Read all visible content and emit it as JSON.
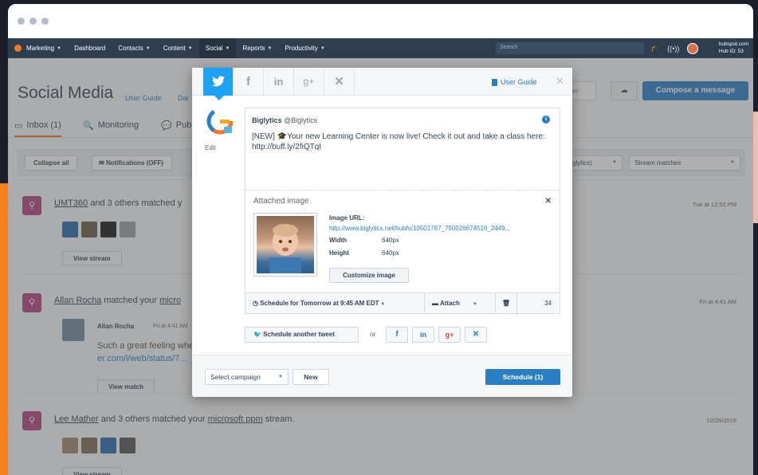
{
  "nav": {
    "brand": "Marketing",
    "items": [
      "Dashboard",
      "Contacts",
      "Content",
      "Social",
      "Reports",
      "Productivity"
    ],
    "search_placeholder": "Search",
    "hub_line1": "hubspot.com",
    "hub_line2": "Hub ID: 53"
  },
  "page": {
    "title": "Social Media",
    "user_guide": "User Guide",
    "title_link2": "Dai",
    "filter_btn": "fter",
    "compose": "Compose a message",
    "tabs": [
      "Inbox (1)",
      "Monitoring",
      "Pub"
    ]
  },
  "filterbar": {
    "collapse": "Collapse all",
    "notifications": "Notifications (OFF)",
    "account_select": "glytics)",
    "stream_select": "Stream matches"
  },
  "stream": [
    {
      "user": "UMT360",
      "text": " and 3 others matched y",
      "date": "Tue at 12:52 PM",
      "button": "View stream"
    },
    {
      "user": "Allan Rocha",
      "text": " matched your ",
      "stream_link": "micro",
      "date": "Fri at 4:41 AM",
      "author": "Allan Rocha",
      "author_time": "Fri at 4:41 AM",
      "excerpt1": "Such a great feeling whe",
      "excerpt2": "er.com/i/web/status/7...",
      "button": "View match"
    },
    {
      "user": "Lee Mather",
      "text": " and 3 others matched your ",
      "stream_link": "microsoft ppm",
      "text_end": " stream.",
      "date": "10/26/2016",
      "button": "View stream"
    }
  ],
  "modal": {
    "user_guide": "User Guide",
    "edit": "Edit",
    "account_name": "Biglytics",
    "account_handle": "@Biglytics",
    "tweet": "[NEW] 🎓Your new Learning Center is now live! Check it out and take a class here: http://buff.ly/2fiQTqI",
    "attached_title": "Attached image",
    "image_url_label": "Image URL:",
    "image_url": "http://www.biglytics.net/hubfs/10501767_750026674516_2449...",
    "width_label": "Width",
    "width_val": "640px",
    "height_label": "Height",
    "height_val": "640px",
    "customize": "Customize image",
    "schedule_text": "Schedule for Tomorrow at 9:45 AM EDT",
    "attach": "Attach",
    "char_count": "34",
    "schedule_another": "Schedule another tweet",
    "or": "or",
    "select_campaign": "Select campaign",
    "new_btn": "New",
    "schedule_btn": "Schedule (1)"
  },
  "colors": {
    "accent_blue": "#2b7ec3",
    "twitter_blue": "#1da1f2",
    "nav_dark": "#2d3e50",
    "stream_icon": "#b0457a"
  }
}
